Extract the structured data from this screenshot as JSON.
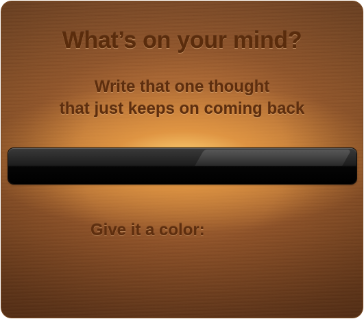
{
  "header": {
    "title": "What’s on your mind?"
  },
  "prompt": {
    "line1": "Write that one thought",
    "line2": "that just keeps on coming back"
  },
  "thought_input": {
    "value": "",
    "placeholder": ""
  },
  "color_picker": {
    "label": "Give it a color:"
  }
}
